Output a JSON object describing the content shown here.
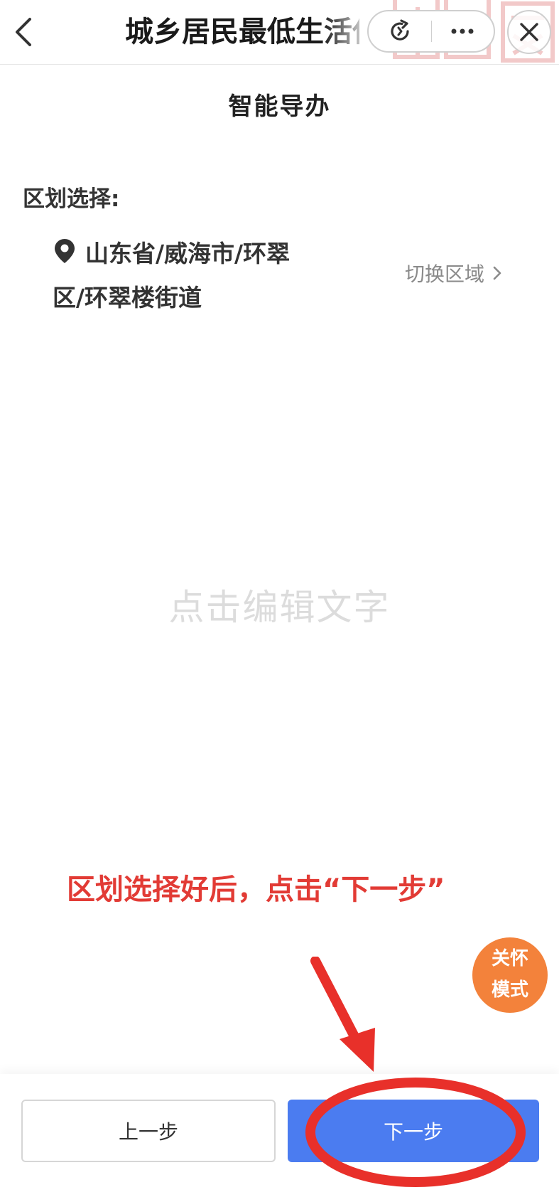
{
  "header": {
    "title": "城乡居民最低生活保障",
    "colors": {
      "border": "#cfcfcf"
    }
  },
  "main": {
    "section_title": "智能导办",
    "region_label": "区划选择:",
    "location_line1": "山东省/威海市/环翠",
    "location_line2": "区/环翠楼街道",
    "switch_label": "切换区域",
    "placeholder": "点击编辑文字"
  },
  "annotation": {
    "text": "区划选择好后，点击“下一步”",
    "color": "#e23b35"
  },
  "care_mode": {
    "line1": "关怀",
    "line2": "模式",
    "color": "#f3823b"
  },
  "footer": {
    "prev_label": "上一步",
    "next_label": "下一步",
    "next_color": "#4b7cf0"
  }
}
